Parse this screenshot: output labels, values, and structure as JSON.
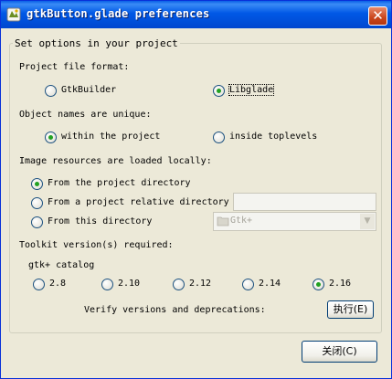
{
  "window": {
    "title": "gtkButton.glade preferences",
    "close_glyph": "✕"
  },
  "group_title": "Set options in your project",
  "file_format": {
    "label": "Project file format:",
    "options": [
      {
        "label": "GtkBuilder",
        "checked": false
      },
      {
        "label": "Libglade",
        "checked": true
      }
    ]
  },
  "object_names": {
    "label": "Object names are unique:",
    "options": [
      {
        "label": "within the project",
        "checked": true
      },
      {
        "label": "inside toplevels",
        "checked": false
      }
    ]
  },
  "image_resources": {
    "label": "Image resources are loaded locally:",
    "options": [
      {
        "label": "From the project directory",
        "checked": true
      },
      {
        "label": "From a project relative directory",
        "checked": false
      },
      {
        "label": "From this directory",
        "checked": false
      }
    ],
    "relative_dir_value": "",
    "directory_combo": "Gtk+"
  },
  "toolkit": {
    "label": "Toolkit version(s) required:",
    "catalog": "gtk+ catalog",
    "versions": [
      {
        "label": "2.8",
        "checked": false
      },
      {
        "label": "2.10",
        "checked": false
      },
      {
        "label": "2.12",
        "checked": false
      },
      {
        "label": "2.14",
        "checked": false
      },
      {
        "label": "2.16",
        "checked": true
      }
    ],
    "verify_label": "Verify versions and deprecations:",
    "execute_button": "执行(E)"
  },
  "close_button": "关闭(C)"
}
